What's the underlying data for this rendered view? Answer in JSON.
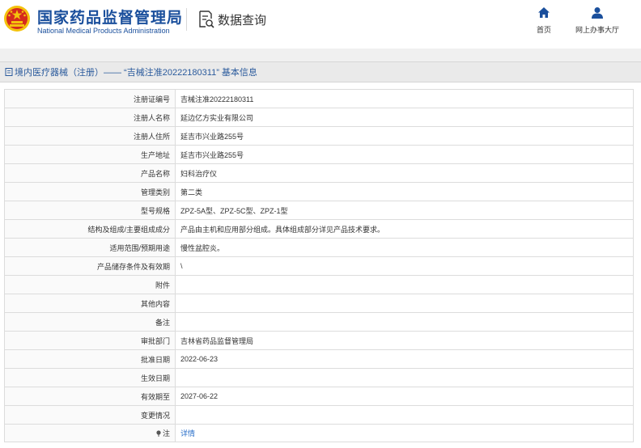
{
  "header": {
    "org_name": "国家药品监督管理局",
    "org_name_en": "National Medical Products Administration",
    "query_label": "数据查询",
    "nav": {
      "home_label": "首页",
      "hall_label": "网上办事大厅"
    },
    "colors": {
      "brand": "#1a4f9c",
      "emblem_red": "#d52b1e",
      "emblem_gold": "#f4c20d"
    }
  },
  "breadcrumb": {
    "text": "境内医疗器械（注册）—— “吉械注准20222180311” 基本信息"
  },
  "detail": {
    "rows": [
      {
        "label": "注册证编号",
        "value": "吉械注准20222180311"
      },
      {
        "label": "注册人名称",
        "value": "延边亿方实业有限公司"
      },
      {
        "label": "注册人住所",
        "value": "延吉市兴业路255号"
      },
      {
        "label": "生产地址",
        "value": "延吉市兴业路255号"
      },
      {
        "label": "产品名称",
        "value": "妇科治疗仪"
      },
      {
        "label": "管理类别",
        "value": "第二类"
      },
      {
        "label": "型号规格",
        "value": "ZPZ-5A型、ZPZ-5C型、ZPZ-1型"
      },
      {
        "label": "结构及组成/主要组成成分",
        "value": "产品由主机和应用部分组成。具体组成部分详见产品技术要求。"
      },
      {
        "label": "适用范围/预期用途",
        "value": "慢性盆腔炎。"
      },
      {
        "label": "产品储存条件及有效期",
        "value": "\\"
      },
      {
        "label": "附件",
        "value": ""
      },
      {
        "label": "其他内容",
        "value": ""
      },
      {
        "label": "备注",
        "value": ""
      },
      {
        "label": "审批部门",
        "value": "吉林省药品监督管理局"
      },
      {
        "label": "批准日期",
        "value": "2022-06-23"
      },
      {
        "label": "生效日期",
        "value": ""
      },
      {
        "label": "有效期至",
        "value": "2027-06-22"
      },
      {
        "label": "变更情况",
        "value": ""
      }
    ],
    "note": {
      "label": "注",
      "link_text": "详情"
    }
  }
}
